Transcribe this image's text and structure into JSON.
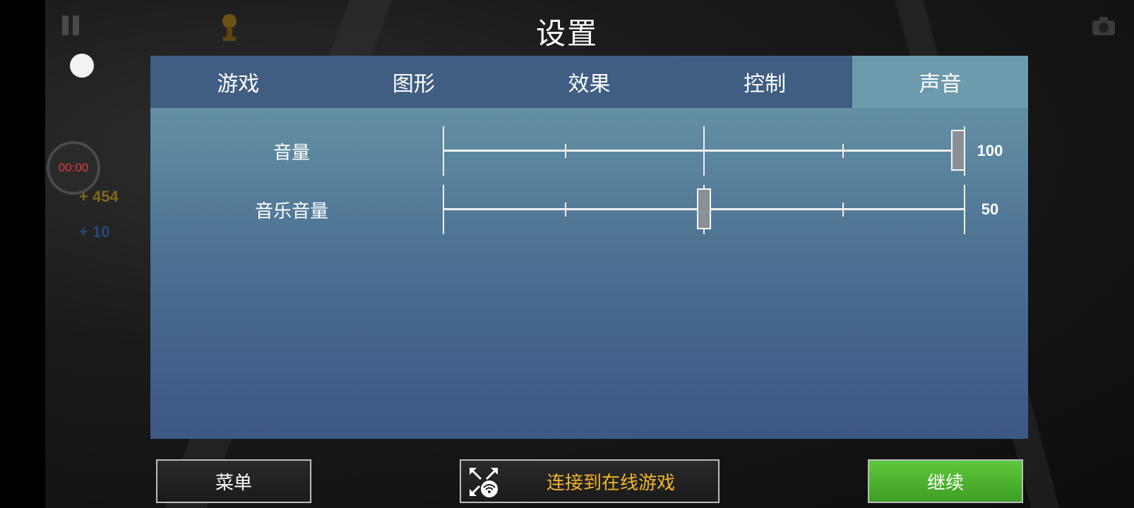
{
  "title": "设置",
  "tabs": [
    {
      "label": "游戏",
      "active": false
    },
    {
      "label": "图形",
      "active": false
    },
    {
      "label": "效果",
      "active": false
    },
    {
      "label": "控制",
      "active": false
    },
    {
      "label": "声音",
      "active": true
    }
  ],
  "sliders": [
    {
      "label": "音量",
      "value": "100",
      "level": 1.0
    },
    {
      "label": "音乐音量",
      "value": "50",
      "level": 0.5
    }
  ],
  "hud": {
    "timer": "00:00",
    "coins": "+ 454",
    "gems": "+ 10"
  },
  "buttons": {
    "menu": "菜单",
    "online": "连接到在线游戏",
    "continue": "继续"
  },
  "colors": {
    "tab_bg": "#3f5e82",
    "tab_active_bg": "#6d9aac",
    "online_text": "#f2b62a",
    "continue_bg": "#4fb530",
    "timer_text": "#e23b3b"
  },
  "icons": [
    "pause-icon",
    "camera-icon",
    "trophy-icon",
    "online-connect-icon"
  ]
}
